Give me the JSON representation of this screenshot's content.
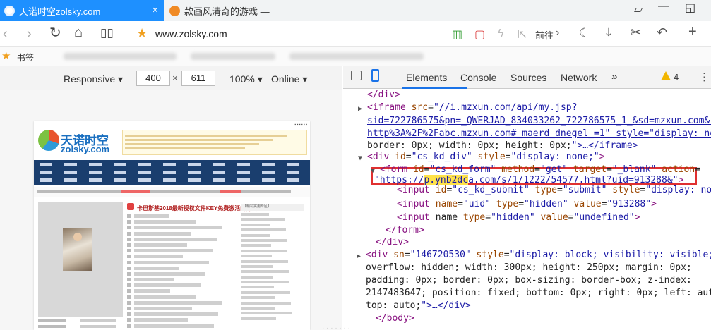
{
  "browser": {
    "tabs": [
      {
        "title": "天诺时空zolsky.com",
        "close": "×"
      },
      {
        "title": "款画风清奇的游戏 —"
      }
    ],
    "url": "www.zolsky.com",
    "forward_label": "前往",
    "bookmarks_label": "书签"
  },
  "device_toolbar": {
    "mode": "Responsive",
    "width": "400",
    "height": "611",
    "zoom": "100%",
    "network": "Online",
    "times": "×"
  },
  "devtools": {
    "tabs": [
      "Elements",
      "Console",
      "Sources",
      "Network",
      "»"
    ],
    "active_tab": "Elements",
    "warning_count": "4",
    "dom_lines": [
      "</div>",
      "<iframe src=\"//i.mzxun.com/api/my.jsp?",
      "sid=722786575&pn=_QWERJAD_834033262_722786575_1_&sd=mzxun.com&rss=",
      "http%3A%2F%2Fabc.mzxun.com#_maerd_dnegel_=1\" style=\"display: none;",
      "border: 0px; width: 0px; height: 0px;\">…</iframe>",
      "<div id=\"cs_kd_div\" style=\"display: none;\">",
      "<form id=\"cs_kd_form\" method=\"get\" target=\"_blank\" action=",
      "\"https://p.ynb2dca.com/s/1/1222/54577.html?uid=913288&\">",
      "<input id=\"cs_kd_submit\" type=\"submit\" style=\"display: none;\">",
      "<input name=\"uid\" type=\"hidden\" value=\"913288\">",
      "<input name type=\"hidden\" value=\"undefined\">",
      "</form>",
      "</div>",
      "<div sn=\"146720530\" style=\"display: block; visibility: visible;",
      "overflow: hidden; width: 300px; height: 250px; margin: 0px;",
      "padding: 0px; border: 0px; box-sizing: border-box; z-index:",
      "2147483647; position: fixed; bottom: 0px; right: 0px; left: auto;",
      "top: auto;\">…</div>",
      "</body>"
    ],
    "highlight_host": "p.ynb2dc"
  },
  "site": {
    "logo_cn": "天诺时空",
    "logo_en": "zolsky.com",
    "headline": "卡巴斯基2018最新授权文件KEY免费激活的方法",
    "right_head": "【精彩实用专区】"
  },
  "colors": {
    "accent": "#1e90ff",
    "nav": "#1a3e6e",
    "highlight": "#e03030"
  }
}
